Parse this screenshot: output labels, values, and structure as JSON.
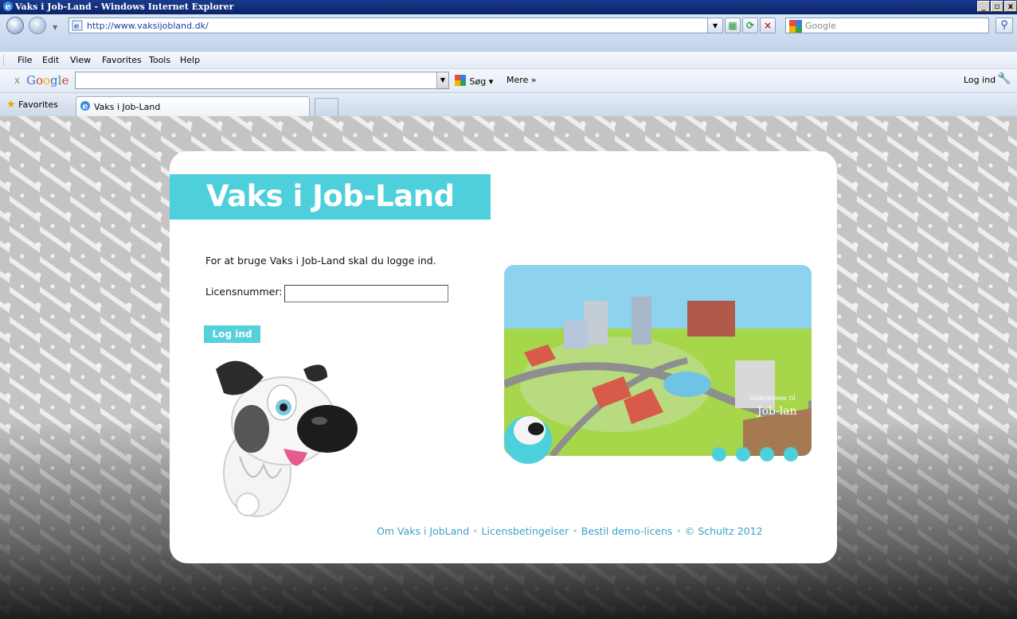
{
  "window": {
    "title": "Vaks i Job-Land - Windows Internet Explorer",
    "controls": [
      "_",
      "ø",
      "x"
    ]
  },
  "address": {
    "url": "http://www.vaksijobland.dk/",
    "search_placeholder": "Google"
  },
  "menu": {
    "items": [
      "File",
      "Edit",
      "View",
      "Favorites",
      "Tools",
      "Help"
    ]
  },
  "google_toolbar": {
    "close": "x",
    "logo": "Google",
    "search_button": "Søg",
    "more": "Mere »",
    "login": "Log ind"
  },
  "tabs": {
    "favorites_label": "Favorites",
    "active_tab": "Vaks i Job-Land"
  },
  "page": {
    "banner_title": "Vaks i Job-Land",
    "intro": "For at bruge Vaks i Job-Land skal du logge ind.",
    "license_label": "Licensnummer:",
    "license_value": "",
    "login_button": "Log ind",
    "city_sign": [
      "Velkommen til",
      "Job-lan"
    ],
    "footer_links": [
      "Om Vaks i JobLand",
      "Licensbetingelser",
      "Bestil demo-licens",
      "© Schultz 2012"
    ]
  },
  "colors": {
    "banner": "#4ecfdc",
    "link": "#3aa3c8",
    "titlebar": "#0a246a"
  }
}
